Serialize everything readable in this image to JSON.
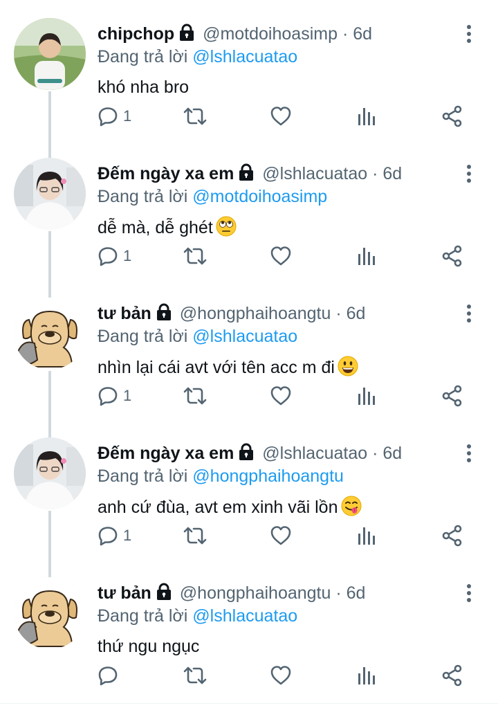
{
  "tweets": [
    {
      "name": "chipchop",
      "handle": "@motdoihoasimp",
      "separator": "·",
      "time": "6d",
      "reply_prefix": "Đang trả lời",
      "reply_to": "@lshlacuatao",
      "text": "khó nha bro",
      "emoji": "",
      "reply_count": "1",
      "avatar": "boy-photo"
    },
    {
      "name": "Đếm ngày xa em",
      "handle": "@lshlacuatao",
      "separator": "·",
      "time": "6d",
      "reply_prefix": "Đang trả lời",
      "reply_to": "@motdoihoasimp",
      "text": "dễ mà, dễ ghét",
      "emoji": "face-with-rolling-eyes",
      "reply_count": "1",
      "avatar": "girl-photo"
    },
    {
      "name": "tư bản",
      "handle": "@hongphaihoangtu",
      "separator": "·",
      "time": "6d",
      "reply_prefix": "Đang trả lời",
      "reply_to": "@lshlacuatao",
      "text": "nhìn lại cái avt với tên acc m đi",
      "emoji": "grinning-face",
      "reply_count": "1",
      "avatar": "dog-cartoon"
    },
    {
      "name": "Đếm ngày xa em",
      "handle": "@lshlacuatao",
      "separator": "·",
      "time": "6d",
      "reply_prefix": "Đang trả lời",
      "reply_to": "@hongphaihoangtu",
      "text": "anh cứ đùa, avt em xinh vãi lồn",
      "emoji": "face-savoring-food",
      "reply_count": "1",
      "avatar": "girl-photo"
    },
    {
      "name": "tư bản",
      "handle": "@hongphaihoangtu",
      "separator": "·",
      "time": "6d",
      "reply_prefix": "Đang trả lời",
      "reply_to": "@lshlacuatao",
      "text": "thứ ngu ngục",
      "emoji": "",
      "reply_count": "",
      "avatar": "dog-cartoon"
    }
  ],
  "colors": {
    "text": "#0f1419",
    "secondary": "#536471",
    "mention": "#1d9bf0",
    "thread_line": "#cfd9de"
  },
  "icons": {
    "reply": "speech-bubble-icon",
    "retweet": "retweet-icon",
    "like": "heart-icon",
    "views": "bar-chart-icon",
    "share": "share-icon",
    "more": "three-dots-vertical-icon",
    "protected": "lock-icon"
  }
}
